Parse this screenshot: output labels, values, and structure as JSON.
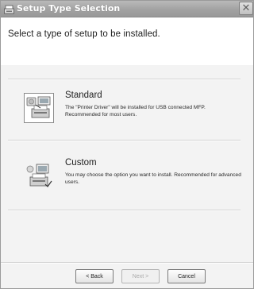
{
  "window": {
    "title": "Setup Type Selection"
  },
  "header": {
    "text": "Select a type of setup to be installed."
  },
  "options": [
    {
      "title": "Standard",
      "description": "The \"Printer Driver\" will be installed for USB connected MFP. Recommended for most users."
    },
    {
      "title": "Custom",
      "description": "You may choose the option you want to install. Recommended for advanced users."
    }
  ],
  "buttons": {
    "back": "< Back",
    "next": "Next >",
    "cancel": "Cancel"
  },
  "icons": {
    "app": "installer-icon",
    "close": "close-icon",
    "standard": "standard-setup-icon",
    "custom": "custom-setup-icon"
  }
}
